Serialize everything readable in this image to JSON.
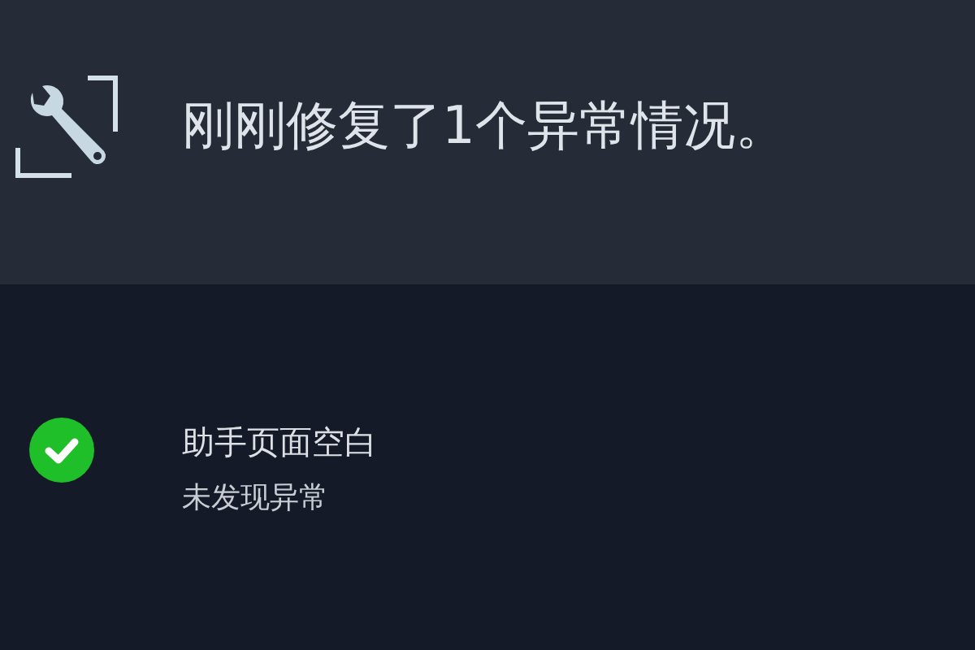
{
  "header": {
    "message": "刚刚修复了1个异常情况。"
  },
  "checks": [
    {
      "title": "助手页面空白",
      "result": "未发现异常",
      "passed": true
    }
  ]
}
